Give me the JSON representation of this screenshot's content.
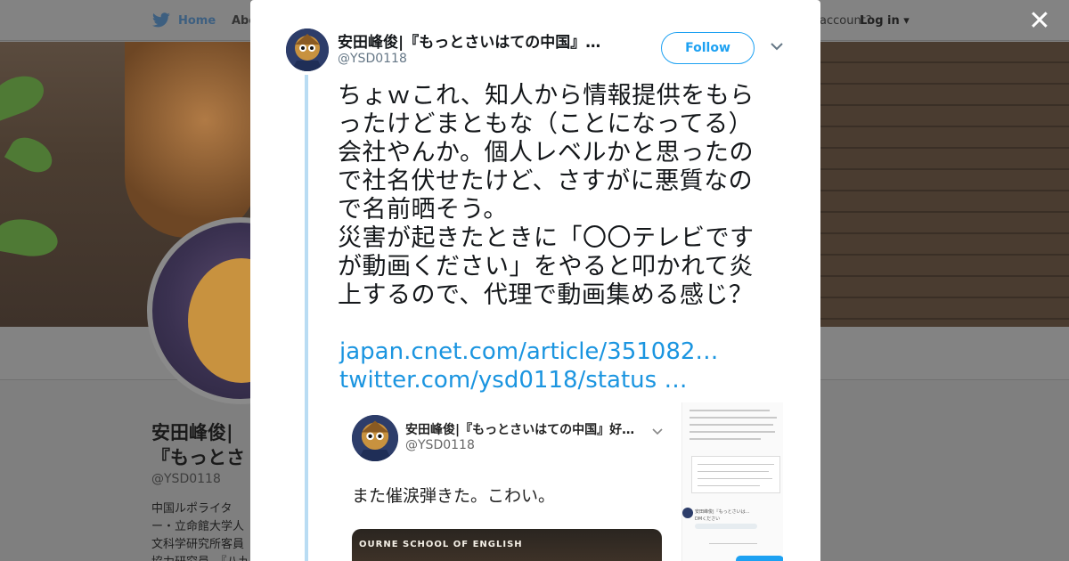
{
  "nav": {
    "home_label": "Home",
    "about_label": "Abo",
    "account_question": "account?",
    "login_label": "Log in"
  },
  "profile": {
    "name_partial": "安田峰俊|『もっとさいはての中国』好",
    "handle": "@YSD0118",
    "bio_partial": "中国ルポライター・立命館大学人文科学研究所客員協力研究員。『八九六四 「天安門事件」は再び起きるか』（KADOKAWA）"
  },
  "tweet": {
    "author_name": "安田峰俊|『もっとさいはての中国』…",
    "author_handle": "@YSD0118",
    "follow_label": "Follow",
    "text_lines": [
      "ちょｗこれ、知人から情報提供をもら",
      "ったけどまともな（ことになってる）",
      "会社やんか。個人レベルかと思ったの",
      "で社名伏せたけど、さすがに悪質なの",
      "で名前晒そう。",
      "災害が起きたときに「〇〇テレビです",
      "が動画ください」をやると叩かれて炎",
      "上するので、代理で動画集める感じ？"
    ],
    "links": [
      "japan.cnet.com/article/351082…",
      "twitter.com/ysd0118/status …"
    ]
  },
  "embed": {
    "author_name": "安田峰俊|『もっとさいはての中国』好…",
    "author_handle": "@YSD0118",
    "text": "また催涙弾きた。こわい。",
    "video_caption": "OURNE SCHOOL OF ENGLISH",
    "side_name": "安田峰俊|『もっとさいは…",
    "side_dm": "DMください"
  },
  "colors": {
    "link": "#1b95e0",
    "follow": "#1da1f2",
    "thread_line": "#b9dcf3"
  },
  "icons": [
    "twitter-bird-icon",
    "close-icon",
    "chevron-down-icon"
  ]
}
